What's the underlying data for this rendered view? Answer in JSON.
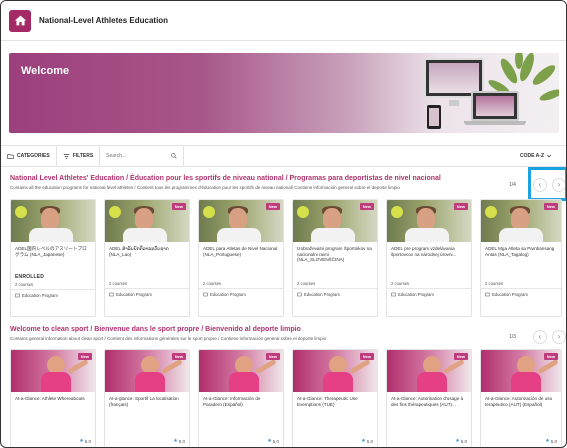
{
  "app": {
    "title": "National-Level Athletes Education"
  },
  "banner": {
    "heading": "Welcome"
  },
  "toolbar": {
    "categories": "CATEGORIES",
    "filters": "FILTERS",
    "search_placeholder": "Search...",
    "sort": "CODE A-Z"
  },
  "sections": [
    {
      "title": "National Level Athletes' Education / Éducation pour les sportifs de niveau national / Programas para deportistas de nivel nacional",
      "description": "Contains all the education programs for national level athletes / Contient tous les programmes d'éducation pour les sportifs de niveau national/ Contiene información general sobre el deporte limpio",
      "pager": "1/4",
      "cards": [
        {
          "title": "ADEL国内レベルのアスリートプログラム (NLA_Japanese)",
          "new": false,
          "enrolled": "ENROLLED",
          "courses": "2 courses",
          "type": "Education Program"
        },
        {
          "title": "ADEL ສຳລັບນັກກິລາລະດັບຊາດ (NLA_Lao)",
          "new": true,
          "enrolled": "",
          "courses": "2 courses",
          "type": "Education Program"
        },
        {
          "title": "ADEL para Atletas de Nivel Nacional (NLA_Portuguese)",
          "new": true,
          "enrolled": "",
          "courses": "2 courses",
          "type": "Education Program"
        },
        {
          "title": "Izobraževalni program Športnikov na nacionalni ravni (NLA_SLOVENŠČINA)",
          "new": true,
          "enrolled": "",
          "courses": "2 courses",
          "type": "Education Program"
        },
        {
          "title": "ADEL pre program vzdelávania športovcov na národnej úrovni...",
          "new": true,
          "enrolled": "",
          "courses": "2 courses",
          "type": "Education Program"
        },
        {
          "title": "ADEL Mga Atleta sa Pambansang Antas (NLA_Tagalog)",
          "new": true,
          "enrolled": "",
          "courses": "2 courses",
          "type": "Education Program"
        }
      ]
    },
    {
      "title": "Welcome to clean sport / Bienvenue dans le sport propre / Bienvenido al deporte limpio",
      "description": "Contains general information about clean sport / Contient des informations générales sur le sport propre / Contiene información general sobre el deporte limpio",
      "pager": "1/3",
      "cards": [
        {
          "title": "At-a-Glance: Athlete Whereabouts",
          "new": true,
          "rating": "5.0"
        },
        {
          "title": "At-a-glance: Sportif La localisation (français)",
          "new": true,
          "rating": "5.0"
        },
        {
          "title": "At-a-Glance: Información de Paradero (Español)",
          "new": true,
          "rating": "5.0"
        },
        {
          "title": "At-a-Glance: Therapeutic Use Exemptions (TUE)",
          "new": true,
          "rating": "5.0"
        },
        {
          "title": "At-a-Glance: Autorisation d'usage à des fins thérapeutiques (AUT)...",
          "new": true,
          "rating": "5.0"
        },
        {
          "title": "At-a-Glance: Autorización de uso terapéutico (AUT) (Español)",
          "new": true,
          "rating": "5.0"
        }
      ]
    }
  ],
  "labels": {
    "new_badge": "New"
  },
  "colors": {
    "accent": "#b0326e",
    "highlight": "#1ba3df"
  },
  "icons": [
    "home-icon",
    "folder-icon",
    "filter-icon",
    "search-icon",
    "chevron-down-icon",
    "chevron-left-icon",
    "chevron-right-icon",
    "program-icon",
    "star-icon"
  ]
}
